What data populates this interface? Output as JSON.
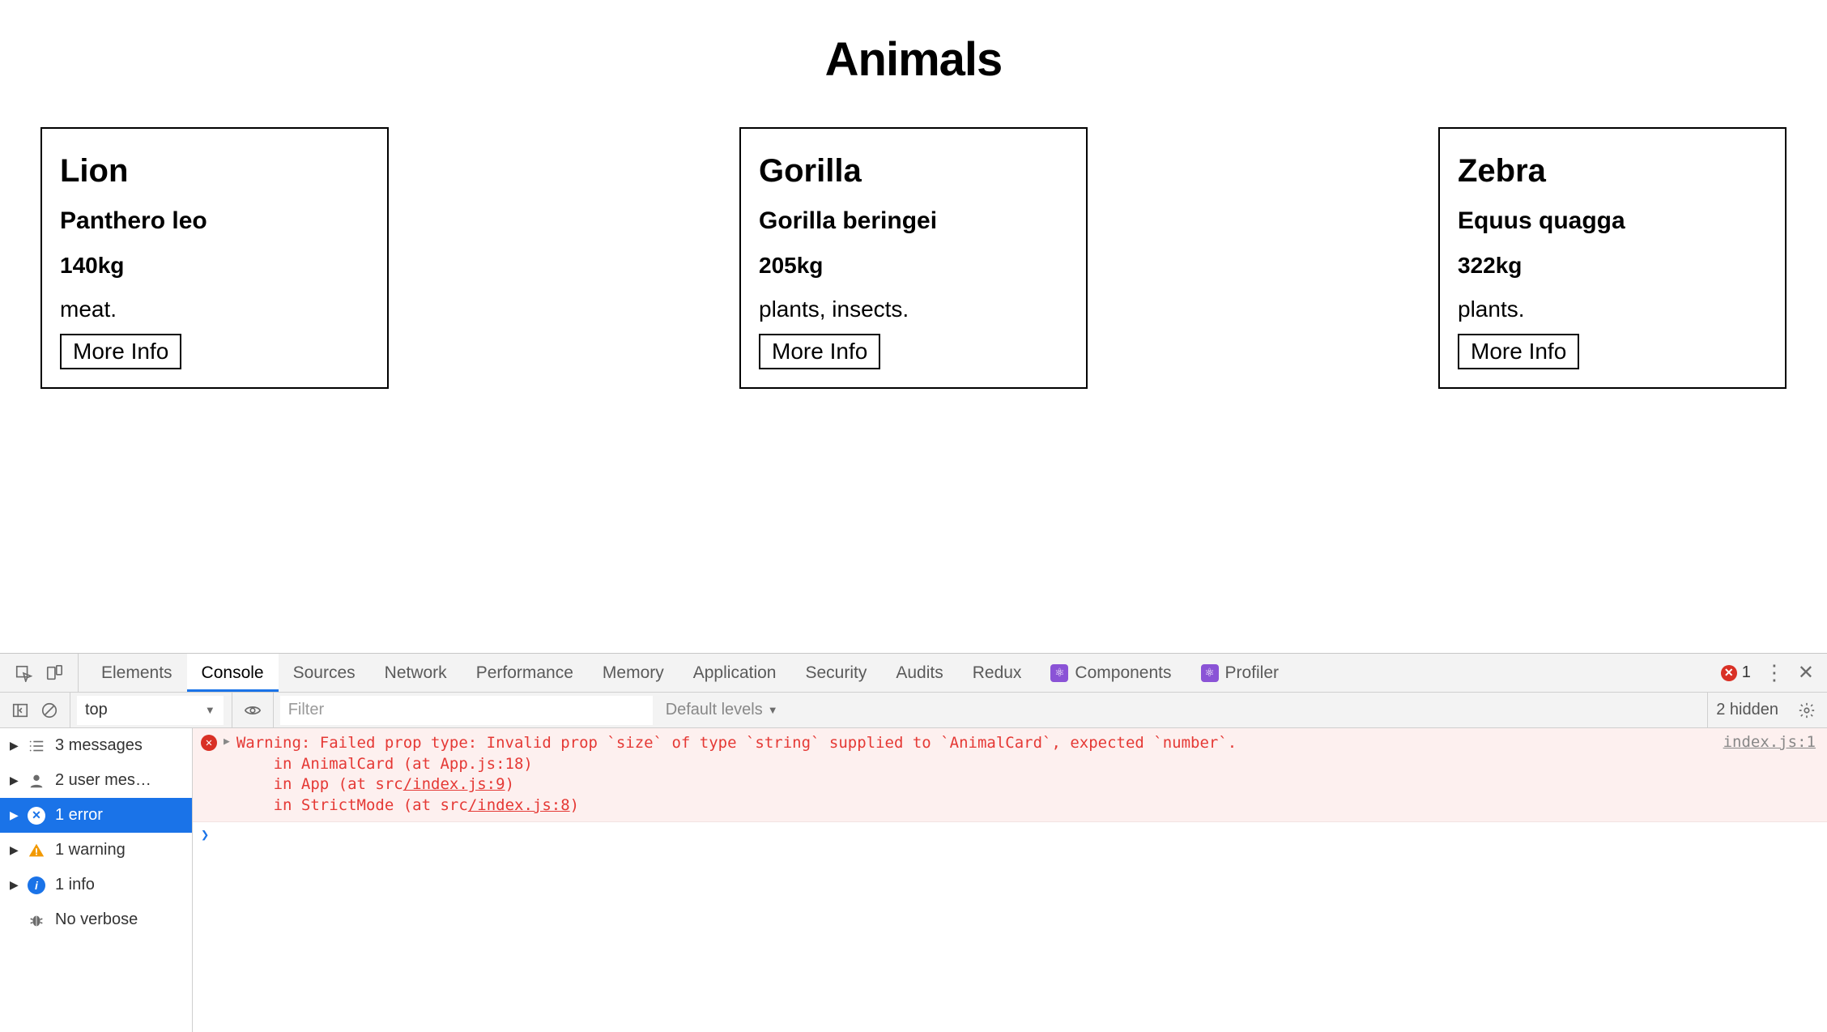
{
  "page": {
    "title": "Animals",
    "more_info_label": "More Info",
    "cards": [
      {
        "name": "Lion",
        "latin": "Panthero leo",
        "weight": "140kg",
        "diet": "meat."
      },
      {
        "name": "Gorilla",
        "latin": "Gorilla beringei",
        "weight": "205kg",
        "diet": "plants, insects."
      },
      {
        "name": "Zebra",
        "latin": "Equus quagga",
        "weight": "322kg",
        "diet": "plants."
      }
    ]
  },
  "devtools": {
    "tabs": {
      "elements": "Elements",
      "console": "Console",
      "sources": "Sources",
      "network": "Network",
      "performance": "Performance",
      "memory": "Memory",
      "application": "Application",
      "security": "Security",
      "audits": "Audits",
      "redux": "Redux",
      "components": "Components",
      "profiler": "Profiler"
    },
    "error_badge_count": "1",
    "toolbar": {
      "context": "top",
      "filter_placeholder": "Filter",
      "levels": "Default levels",
      "hidden": "2 hidden"
    },
    "sidebar": {
      "messages": "3 messages",
      "user": "2 user mes…",
      "errors": "1 error",
      "warnings": "1 warning",
      "info": "1 info",
      "verbose": "No verbose"
    },
    "log": {
      "line1": "Warning: Failed prop type: Invalid prop `size` of type `string` supplied to `AnimalCard`, expected `number`.",
      "line2": "    in AnimalCard (at App.js:18)",
      "line3_a": "    in App (at src",
      "line3_b": "/index.js:9",
      "line3_c": ")",
      "line4_a": "    in StrictMode (at src",
      "line4_b": "/index.js:8",
      "line4_c": ")",
      "source": "index.js:1"
    }
  }
}
